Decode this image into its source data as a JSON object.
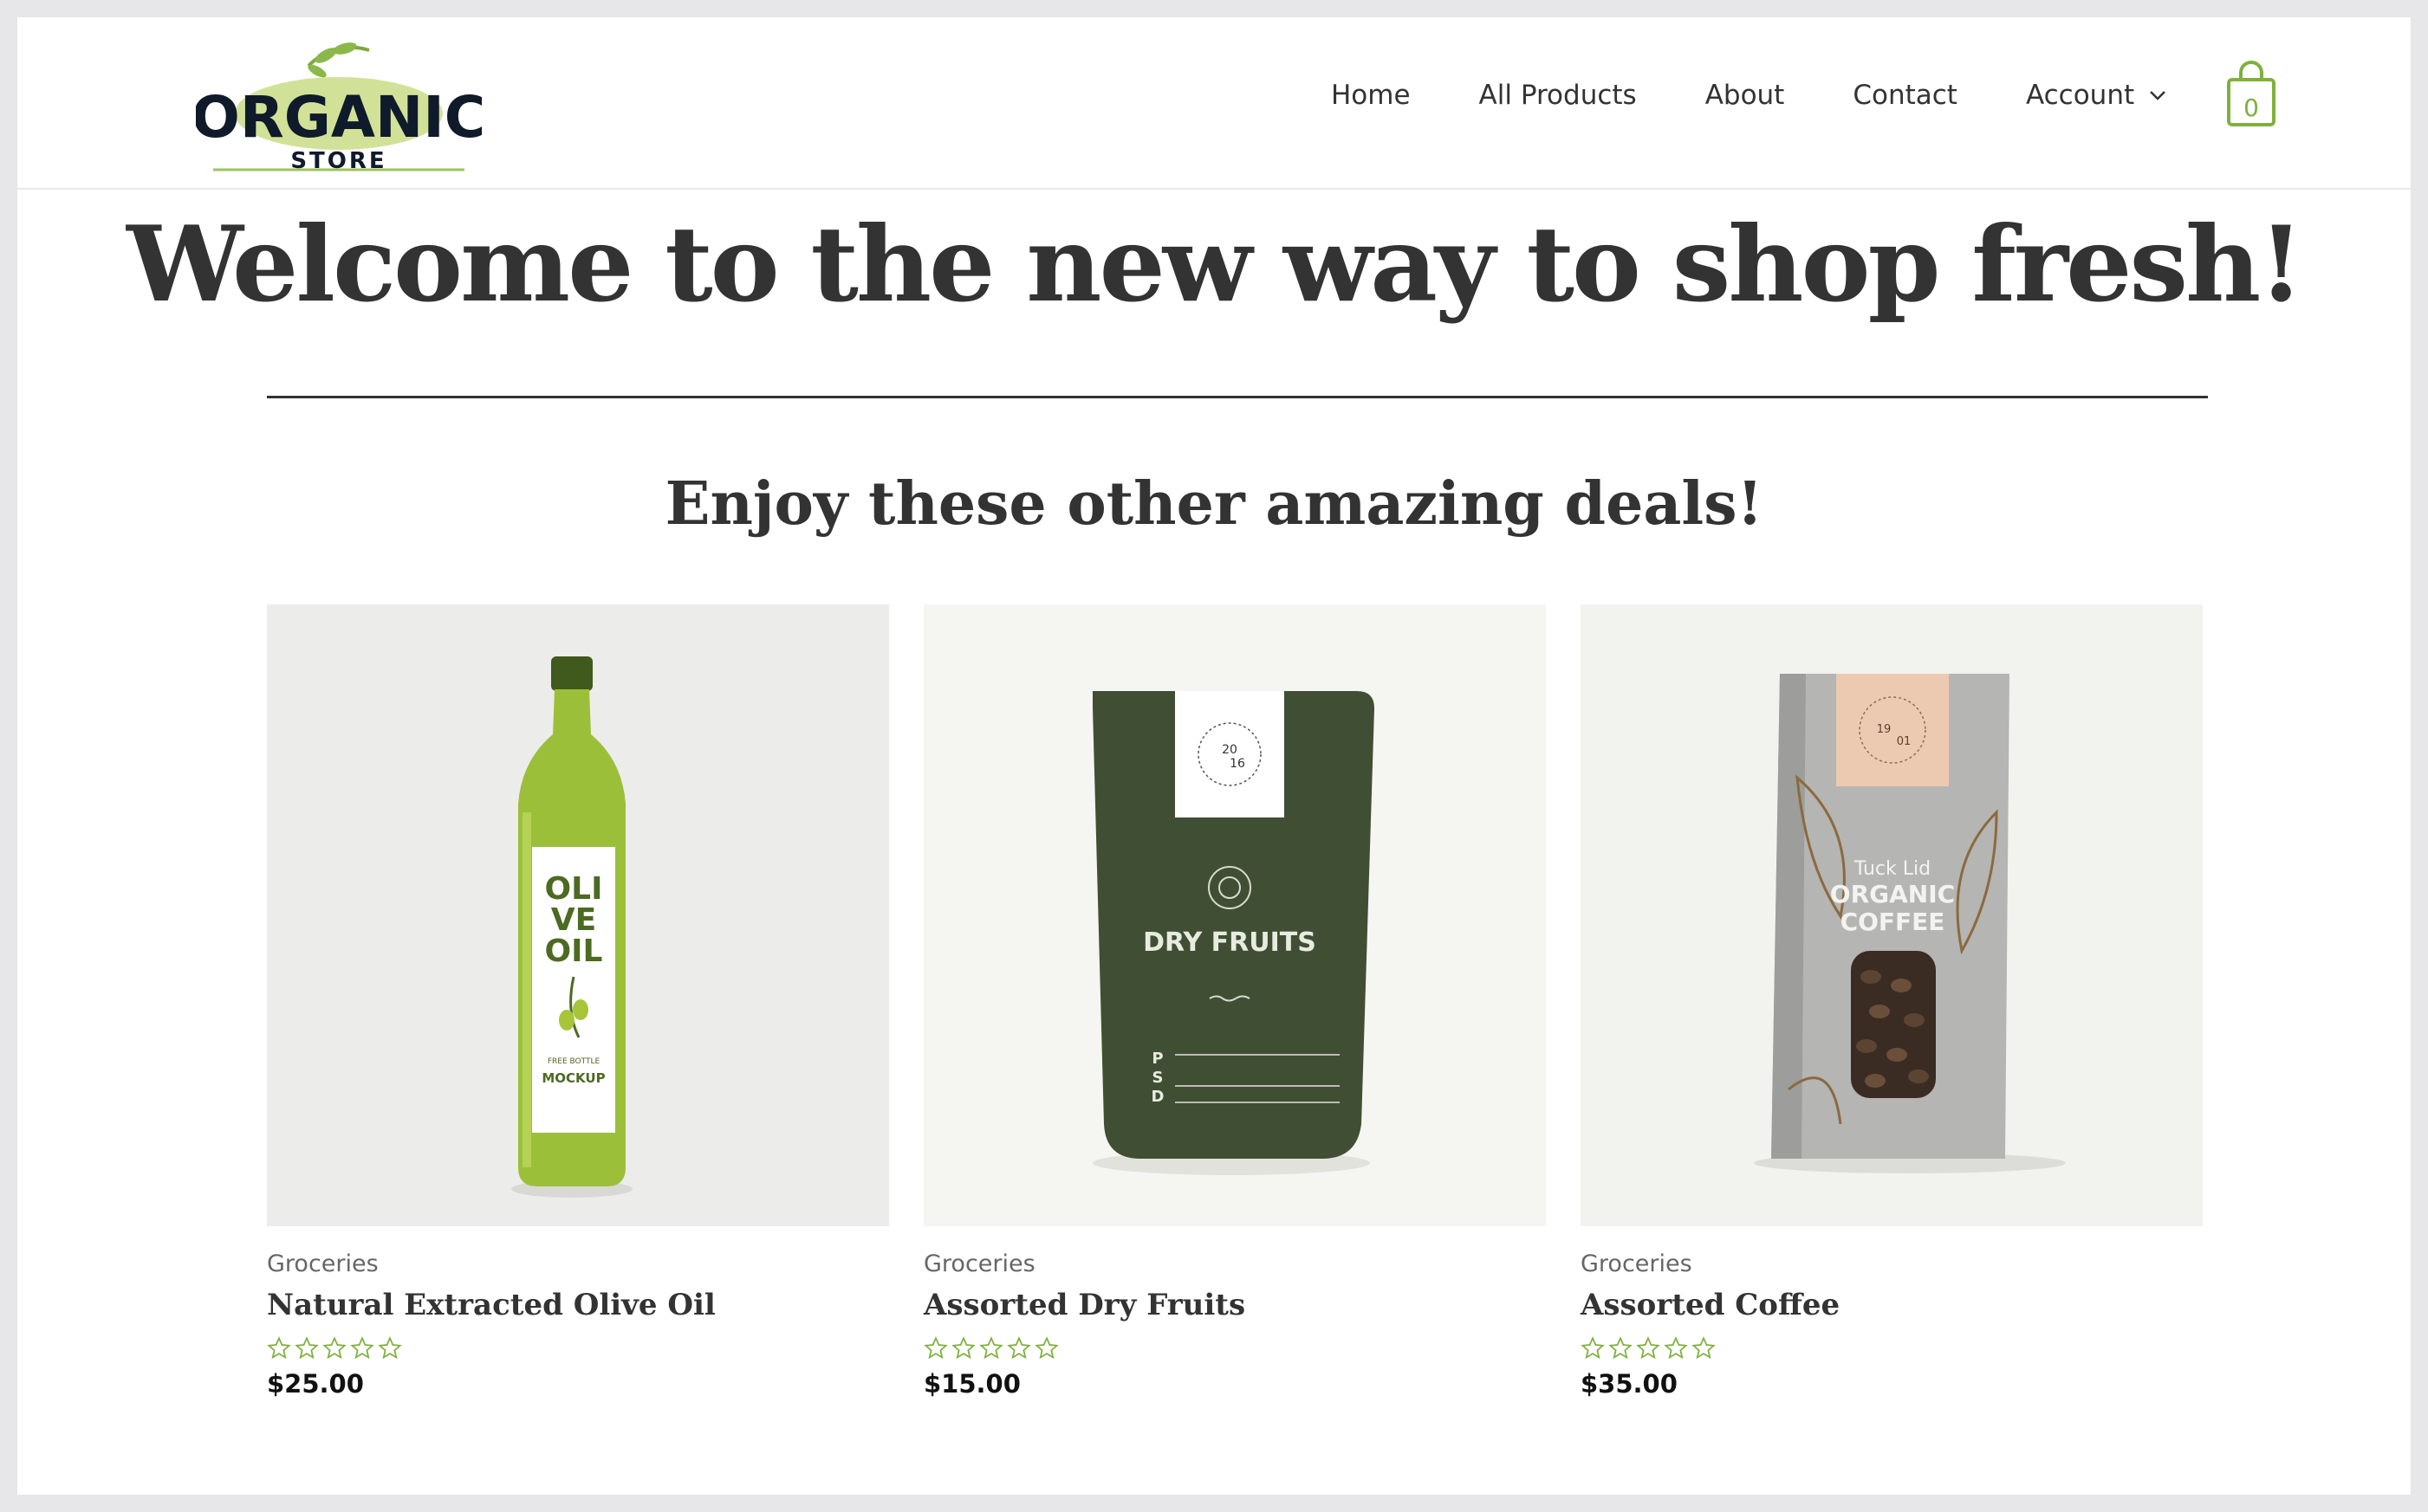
{
  "header": {
    "logo": {
      "title": "ORGANIC",
      "subtitle": "STORE"
    },
    "nav": [
      "Home",
      "All Products",
      "About",
      "Contact"
    ],
    "account_label": "Account",
    "cart_count": "0"
  },
  "hero": {
    "title": "Welcome to the new way to shop fresh!",
    "deals_title": "Enjoy these other amazing deals!"
  },
  "products": [
    {
      "category": "Groceries",
      "name": "Natural Extracted Olive Oil",
      "rating": 0,
      "price": "$25.00",
      "image_icon": "olive-oil-bottle",
      "package_text": [
        "OLI",
        "VE",
        "OIL",
        "FREE BOTTLE",
        "MOCKUP"
      ]
    },
    {
      "category": "Groceries",
      "name": "Assorted Dry Fruits",
      "rating": 0,
      "price": "$15.00",
      "image_icon": "dry-fruits-pouch",
      "package_text": [
        "DRY FRUITS",
        "P",
        "S",
        "D",
        "20",
        "16"
      ]
    },
    {
      "category": "Groceries",
      "name": "Assorted Coffee",
      "rating": 0,
      "price": "$35.00",
      "image_icon": "coffee-box",
      "package_text": [
        "Tuck Lid",
        "ORGANIC",
        "COFFEE",
        "19",
        "01"
      ]
    }
  ],
  "colors": {
    "accent": "#7fb03e",
    "text": "#333333",
    "frame": "#e7e6e9"
  }
}
